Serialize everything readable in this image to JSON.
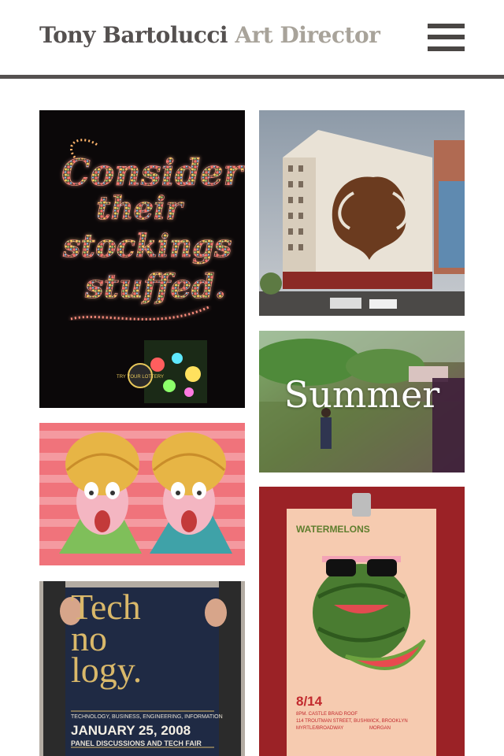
{
  "header": {
    "brand_name": "Tony Bartolucci",
    "brand_role": "Art Director",
    "menu_icon": "hamburger-menu-icon"
  },
  "portfolio": {
    "items": [
      {
        "name": "consider-their-stockings-stuffed",
        "text": "Consider their stockings stuffed.",
        "badge": "TRY YOUR LOTTERY"
      },
      {
        "name": "rorschach-mural-building",
        "text": ""
      },
      {
        "name": "summer",
        "text": "Summer"
      },
      {
        "name": "twin-characters-illustration",
        "text": ""
      },
      {
        "name": "watermelons-poster",
        "title": "WATERMELONS",
        "date": "8/14",
        "details": "8PM. CASTLE BRAID ROOF",
        "address": "114 TROUTMAN STREET, BUSHWICK, BROOKLYN",
        "transit": "MYRTLE/BROADWAY",
        "tail": "MORGAN"
      },
      {
        "name": "technology-poster",
        "line1": "Tech",
        "line2": "no",
        "line3": "logy.",
        "subhead": "TECHNOLOGY, BUSINESS, ENGINEERING, INFORMATION",
        "date": "JANUARY 25, 2008",
        "event": "PANEL DISCUSSIONS AND TECH FAIR"
      }
    ]
  },
  "colors": {
    "brand_name": "#555150",
    "brand_role": "#a8a39a",
    "rule": "#555150"
  }
}
